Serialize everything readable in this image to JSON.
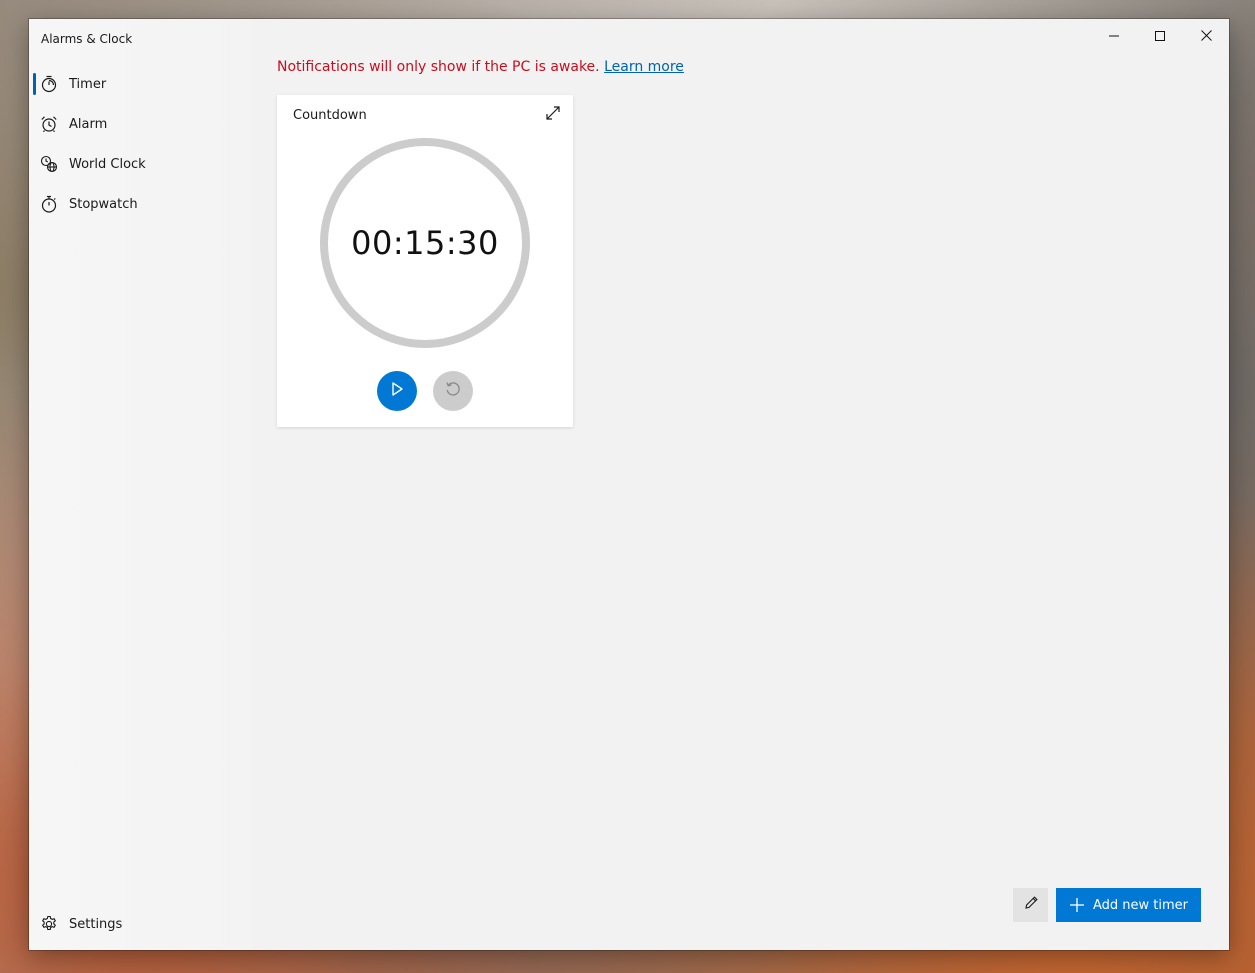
{
  "window": {
    "title": "Alarms & Clock",
    "caption": {
      "minimize_icon": "minimize-icon",
      "maximize_icon": "maximize-icon",
      "close_icon": "close-icon"
    }
  },
  "sidebar": {
    "items": [
      {
        "label": "Timer",
        "icon": "timer-icon",
        "selected": true
      },
      {
        "label": "Alarm",
        "icon": "alarm-clock-icon",
        "selected": false
      },
      {
        "label": "World Clock",
        "icon": "world-clock-icon",
        "selected": false
      },
      {
        "label": "Stopwatch",
        "icon": "stopwatch-icon",
        "selected": false
      }
    ],
    "settings": {
      "label": "Settings",
      "icon": "gear-icon"
    }
  },
  "main": {
    "notice": {
      "text": "Notifications will only show if the PC is awake.",
      "link": "Learn more"
    },
    "timers": [
      {
        "name": "Countdown",
        "time": "00:15:30",
        "expand_icon": "expand-icon",
        "play_icon": "play-icon",
        "reset_icon": "reset-icon"
      }
    ],
    "footer": {
      "edit_icon": "pencil-icon",
      "add_label": "Add new timer",
      "add_icon": "plus-icon"
    }
  },
  "colors": {
    "accent": "#0078d4",
    "notice": "#c50f1f",
    "link": "#0063b1",
    "ring": "#cccccc"
  }
}
